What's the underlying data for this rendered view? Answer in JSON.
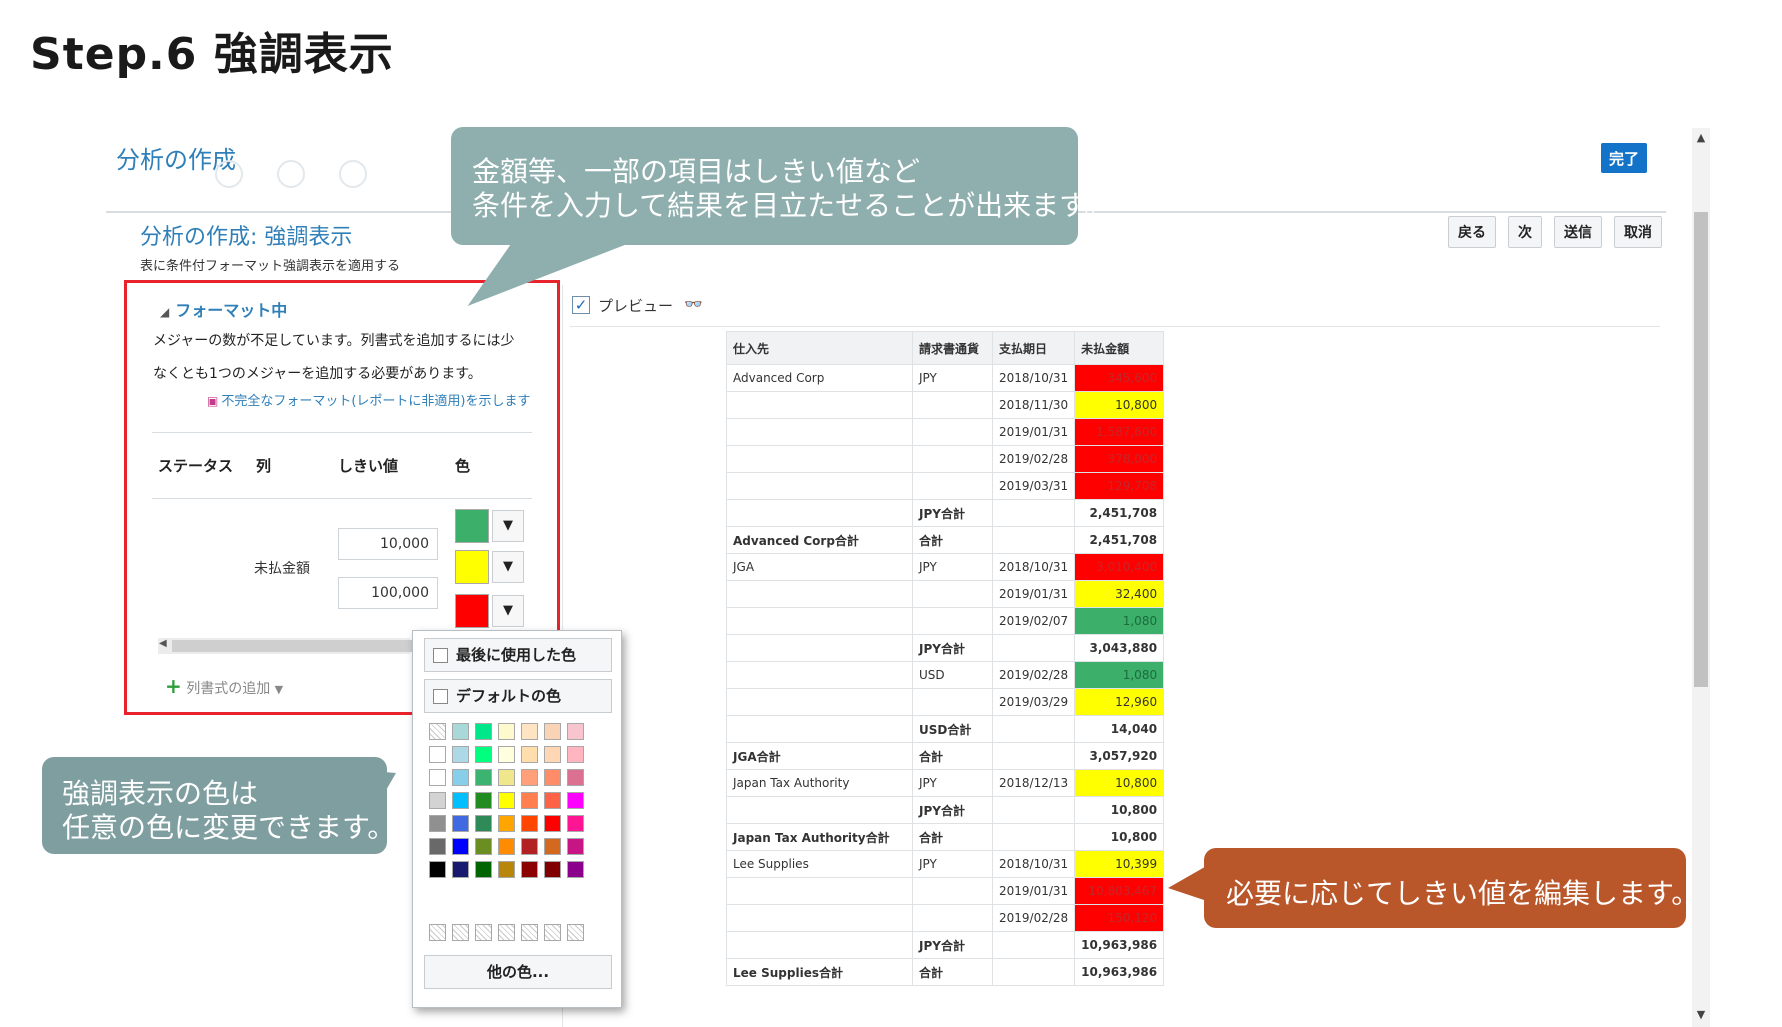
{
  "slide": {
    "title": "Step.6 強調表示"
  },
  "app": {
    "title": "分析の作成",
    "done_label": "完了",
    "step_title": "分析の作成: 強調表示",
    "step_desc": "表に条件付フォーマット強調表示を適用する",
    "nav": {
      "back": "戻る",
      "next": "次",
      "submit": "送信",
      "cancel": "取消"
    }
  },
  "format_panel": {
    "section_title": "フォーマット中",
    "warning_line1": "メジャーの数が不足しています。列書式を追加するには少",
    "warning_line2": "なくとも1つのメジャーを追加する必要があります。",
    "show_link": "不完全なフォーマット(レポートに非適用)を示します",
    "headers": {
      "status": "ステータス",
      "column": "列",
      "threshold": "しきい値",
      "color": "色"
    },
    "column_name": "未払金額",
    "thresholds": [
      "10,000",
      "100,000"
    ],
    "colors": [
      "#3cb06b",
      "#ffff00",
      "#ff0000"
    ],
    "add_column": "列書式の追加"
  },
  "color_popup": {
    "recent_label": "最後に使用した色",
    "default_label": "デフォルトの色",
    "other_label": "他の色...",
    "palette": [
      [
        "",
        "#a8d8d8",
        "#00e68a",
        "#fffacd",
        "#ffe4c4",
        "#f9d3b6",
        "#f7c4d0"
      ],
      [
        "#ffffff",
        "#add8e6",
        "#00ff7f",
        "#ffffe0",
        "#ffdead",
        "#ffd7b5",
        "#ffb6c1"
      ],
      [
        "#ffffff",
        "#87ceeb",
        "#3cb371",
        "#f0e68c",
        "#ffa07a",
        "#ff8c69",
        "#db7093"
      ],
      [
        "#d3d3d3",
        "#00bfff",
        "#228b22",
        "#ffff00",
        "#ff7f50",
        "#ff6347",
        "#ff00ff"
      ],
      [
        "#909090",
        "#4169e1",
        "#2e8b57",
        "#ffa500",
        "#ff4500",
        "#ff0000",
        "#ff1493"
      ],
      [
        "#696969",
        "#0000ff",
        "#6b8e23",
        "#ff8c00",
        "#b22222",
        "#d2691e",
        "#c71585"
      ],
      [
        "#000000",
        "#191970",
        "#006400",
        "#b8860b",
        "#8b0000",
        "#800000",
        "#8b008b"
      ]
    ]
  },
  "preview": {
    "label": "プレビュー",
    "icon": "binoculars-icon"
  },
  "table": {
    "headers": [
      "仕入先",
      "請求書通貨",
      "支払期日",
      "未払金額"
    ],
    "rows": [
      {
        "c1": "Advanced Corp",
        "c2": "JPY",
        "c3": "2018/10/31",
        "c4": "345,600",
        "hl": "red"
      },
      {
        "c1": "",
        "c2": "",
        "c3": "2018/11/30",
        "c4": "10,800",
        "hl": "yel"
      },
      {
        "c1": "",
        "c2": "",
        "c3": "2019/01/31",
        "c4": "1,587,600",
        "hl": "red"
      },
      {
        "c1": "",
        "c2": "",
        "c3": "2019/02/28",
        "c4": "378,000",
        "hl": "red"
      },
      {
        "c1": "",
        "c2": "",
        "c3": "2019/03/31",
        "c4": "129,708",
        "hl": "red"
      },
      {
        "c1": "",
        "c2": "JPY合計",
        "c3": "",
        "c4": "2,451,708",
        "hl": "",
        "sub": true
      },
      {
        "c1": "Advanced Corp合計",
        "c2": "合計",
        "c3": "",
        "c4": "2,451,708",
        "hl": "",
        "total": true
      },
      {
        "c1": "JGA",
        "c2": "JPY",
        "c3": "2018/10/31",
        "c4": "3,010,400",
        "hl": "red"
      },
      {
        "c1": "",
        "c2": "",
        "c3": "2019/01/31",
        "c4": "32,400",
        "hl": "yel"
      },
      {
        "c1": "",
        "c2": "",
        "c3": "2019/02/07",
        "c4": "1,080",
        "hl": "grn"
      },
      {
        "c1": "",
        "c2": "JPY合計",
        "c3": "",
        "c4": "3,043,880",
        "hl": "",
        "sub": true
      },
      {
        "c1": "",
        "c2": "USD",
        "c3": "2019/02/28",
        "c4": "1,080",
        "hl": "grn"
      },
      {
        "c1": "",
        "c2": "",
        "c3": "2019/03/29",
        "c4": "12,960",
        "hl": "yel"
      },
      {
        "c1": "",
        "c2": "USD合計",
        "c3": "",
        "c4": "14,040",
        "hl": "",
        "sub": true
      },
      {
        "c1": "JGA合計",
        "c2": "合計",
        "c3": "",
        "c4": "3,057,920",
        "hl": "",
        "total": true
      },
      {
        "c1": "Japan Tax Authority",
        "c2": "JPY",
        "c3": "2018/12/13",
        "c4": "10,800",
        "hl": "yel"
      },
      {
        "c1": "",
        "c2": "JPY合計",
        "c3": "",
        "c4": "10,800",
        "hl": "",
        "sub": true
      },
      {
        "c1": "Japan Tax Authority合計",
        "c2": "合計",
        "c3": "",
        "c4": "10,800",
        "hl": "",
        "total": true
      },
      {
        "c1": "Lee Supplies",
        "c2": "JPY",
        "c3": "2018/10/31",
        "c4": "10,399",
        "hl": "yel"
      },
      {
        "c1": "",
        "c2": "",
        "c3": "2019/01/31",
        "c4": "10,803,467",
        "hl": "red"
      },
      {
        "c1": "",
        "c2": "",
        "c3": "2019/02/28",
        "c4": "150,120",
        "hl": "red"
      },
      {
        "c1": "",
        "c2": "JPY合計",
        "c3": "",
        "c4": "10,963,986",
        "hl": "",
        "sub": true
      },
      {
        "c1": "Lee Supplies合計",
        "c2": "合計",
        "c3": "",
        "c4": "10,963,986",
        "hl": "",
        "total": true
      }
    ]
  },
  "callouts": {
    "top_line1": "金額等、一部の項目はしきい値など",
    "top_line2": "条件を入力して結果を目立たせることが出来ます。",
    "left_line1": "強調表示の色は",
    "left_line2": "任意の色に変更できます。",
    "right_line1": "必要に応じてしきい値を編集します。"
  }
}
